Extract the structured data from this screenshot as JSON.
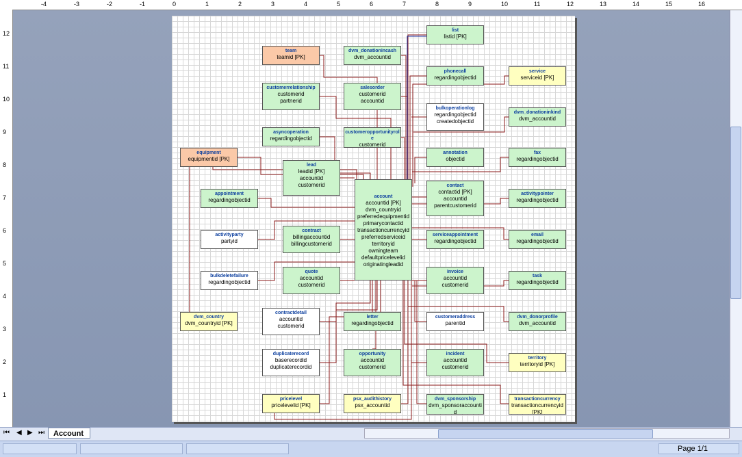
{
  "ruler": {
    "h_ticks": [
      "-4",
      "-3",
      "-2",
      "-1",
      "0",
      "1",
      "2",
      "3",
      "4",
      "5",
      "6",
      "7",
      "8",
      "9",
      "10",
      "11",
      "12",
      "13",
      "14",
      "15",
      "16"
    ],
    "v_ticks": [
      "12",
      "11",
      "10",
      "9",
      "8",
      "7",
      "6",
      "5",
      "4",
      "3",
      "2",
      "1"
    ]
  },
  "entities": {
    "team": {
      "title": "team",
      "fields": [
        "teamid  [PK]"
      ]
    },
    "dvm_donationincash": {
      "title": "dvm_donationincash",
      "fields": [
        "dvm_accountid"
      ]
    },
    "list": {
      "title": "list",
      "fields": [
        "listid  [PK]"
      ]
    },
    "phonecall": {
      "title": "phonecall",
      "fields": [
        "regardingobjectid"
      ]
    },
    "service": {
      "title": "service",
      "fields": [
        "serviceid  [PK]"
      ]
    },
    "customerrelationship": {
      "title": "customerrelationship",
      "fields": [
        "customerid",
        "partnerid"
      ]
    },
    "salesorder": {
      "title": "salesorder",
      "fields": [
        "customerid",
        "accountid"
      ]
    },
    "bulkoperationlog": {
      "title": "bulkoperationlog",
      "fields": [
        "regardingobjectid",
        "createdobjectid"
      ]
    },
    "dvm_donationinkind": {
      "title": "dvm_donationinkind",
      "fields": [
        "dvm_accountid"
      ]
    },
    "asyncoperation": {
      "title": "asyncoperation",
      "fields": [
        "regardingobjectid"
      ]
    },
    "customeropportunityrole": {
      "title": "customeropportunityrol e",
      "fields": [
        "customerid"
      ]
    },
    "equipment": {
      "title": "equipment",
      "fields": [
        "equipmentid  [PK]"
      ]
    },
    "annotation": {
      "title": "annotation",
      "fields": [
        "objectid"
      ]
    },
    "fax": {
      "title": "fax",
      "fields": [
        "regardingobjectid"
      ]
    },
    "lead": {
      "title": "lead",
      "fields": [
        "leadid  [PK]",
        "accountid",
        "customerid"
      ]
    },
    "account": {
      "title": "account",
      "fields": [
        "accountid  [PK]",
        "dvm_countryid",
        "preferredequipmentid",
        "primarycontactid",
        "transactioncurrencyid",
        "preferredserviceid",
        "territoryid",
        "owningteam",
        "defaultpricelevelid",
        "originatingleadid"
      ]
    },
    "contact": {
      "title": "contact",
      "fields": [
        "contactid  [PK]",
        "accountid",
        "parentcustomerid"
      ]
    },
    "appointment": {
      "title": "appointment",
      "fields": [
        "regardingobjectid"
      ]
    },
    "activitypointer": {
      "title": "activitypointer",
      "fields": [
        "regardingobjectid"
      ]
    },
    "activityparty": {
      "title": "activityparty",
      "fields": [
        "partyid"
      ]
    },
    "contract": {
      "title": "contract",
      "fields": [
        "billingaccountid",
        "billingcustomerid"
      ]
    },
    "serviceappointment": {
      "title": "serviceappointment",
      "fields": [
        "regardingobjectid"
      ]
    },
    "email": {
      "title": "email",
      "fields": [
        "regardingobjectid"
      ]
    },
    "bulkdeletefailure": {
      "title": "bulkdeletefailure",
      "fields": [
        "regardingobjectid"
      ]
    },
    "quote": {
      "title": "quote",
      "fields": [
        "accountid",
        "customerid"
      ]
    },
    "invoice": {
      "title": "invoice",
      "fields": [
        "accountid",
        "customerid"
      ]
    },
    "task": {
      "title": "task",
      "fields": [
        "regardingobjectid"
      ]
    },
    "dvm_country": {
      "title": "dvm_country",
      "fields": [
        "dvm_countryid  [PK]"
      ]
    },
    "contractdetail": {
      "title": "contractdetail",
      "fields": [
        "accountid",
        "customerid"
      ]
    },
    "letter": {
      "title": "letter",
      "fields": [
        "regardingobjectid"
      ]
    },
    "customeraddress": {
      "title": "customeraddress",
      "fields": [
        "parentid"
      ]
    },
    "dvm_donorprofile": {
      "title": "dvm_donorprofile",
      "fields": [
        "dvm_accountid"
      ]
    },
    "duplicaterecord": {
      "title": "duplicaterecord",
      "fields": [
        "baserecordid",
        "duplicaterecordid"
      ]
    },
    "opportunity": {
      "title": "opportunity",
      "fields": [
        "accountid",
        "customerid"
      ]
    },
    "incident": {
      "title": "incident",
      "fields": [
        "accountid",
        "customerid"
      ]
    },
    "territory": {
      "title": "territory",
      "fields": [
        "territoryid  [PK]"
      ]
    },
    "pricelevel": {
      "title": "pricelevel",
      "fields": [
        "pricelevelid  [PK]"
      ]
    },
    "psx_audithistory": {
      "title": "psx_audithistory",
      "fields": [
        "psx_accountid"
      ]
    },
    "dvm_sponsorship": {
      "title": "dvm_sponsorship",
      "fields": [
        "dvm_sponsoraccounti d"
      ]
    },
    "transactioncurrency": {
      "title": "transactioncurrency",
      "fields": [
        "transactioncurrencyid  [PK]"
      ]
    }
  },
  "tabs": {
    "active": "Account"
  },
  "status": {
    "page": "Page 1/1"
  },
  "colors": {
    "relation": "#8b1a1a",
    "relation_blue": "#1a2fa0",
    "title": "#0b3e9e"
  }
}
